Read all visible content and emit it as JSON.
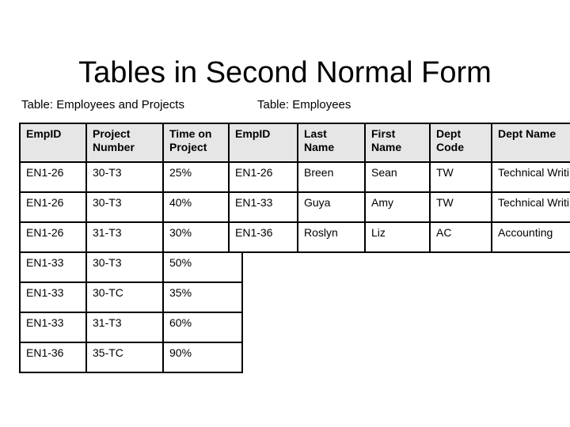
{
  "slide": {
    "title": "Tables in Second Normal Form"
  },
  "tables": [
    {
      "caption": "Table: Employees and Projects",
      "headers": [
        "EmpID",
        "Project Number",
        "Time on Project"
      ],
      "rows": [
        [
          "EN1-26",
          "30-T3",
          "25%"
        ],
        [
          "EN1-26",
          "30-T3",
          "40%"
        ],
        [
          "EN1-26",
          "31-T3",
          "30%"
        ],
        [
          "EN1-33",
          "30-T3",
          "50%"
        ],
        [
          "EN1-33",
          "30-TC",
          "35%"
        ],
        [
          "EN1-33",
          "31-T3",
          "60%"
        ],
        [
          "EN1-36",
          "35-TC",
          "90%"
        ]
      ]
    },
    {
      "caption": "Table: Employees",
      "headers": [
        "EmpID",
        "Last Name",
        "First Name",
        "Dept Code",
        "Dept Name"
      ],
      "rows": [
        [
          "EN1-26",
          "Breen",
          "Sean",
          "TW",
          "Technical Writing"
        ],
        [
          "EN1-33",
          "Guya",
          "Amy",
          "TW",
          "Technical Writing"
        ],
        [
          "EN1-36",
          "Roslyn",
          "Liz",
          "AC",
          "Accounting"
        ]
      ]
    }
  ],
  "colors": {
    "header_background": "#e6e6e6",
    "border": "#000000",
    "text": "#000000",
    "page_background": "#ffffff"
  }
}
